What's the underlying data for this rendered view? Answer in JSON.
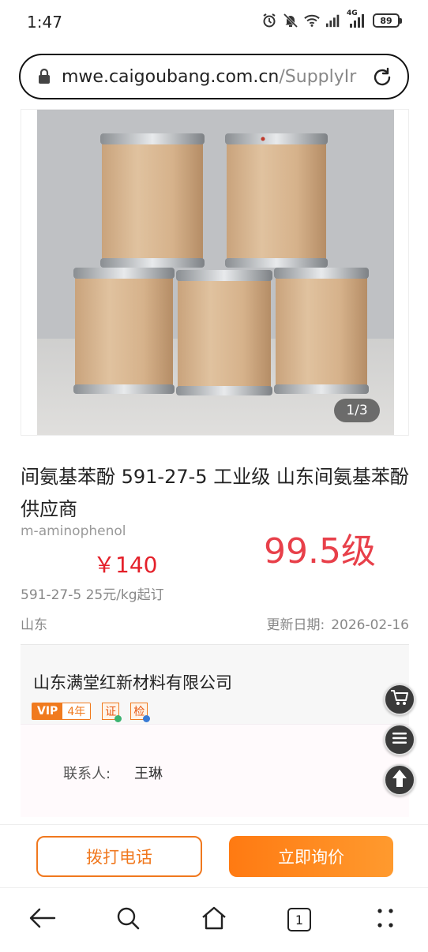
{
  "status_bar": {
    "time": "1:47",
    "battery": "89",
    "network": "4G"
  },
  "browser": {
    "url_domain": "mwe.caigoubang.com.cn",
    "url_path": "/SupplyIr",
    "tab_count": "1"
  },
  "gallery": {
    "counter": "1/3"
  },
  "product": {
    "title": "间氨基苯酚 591-27-5 工业级 山东间氨基苯酚供应商",
    "subtitle": "m-aminophenol",
    "grade": "99.5级",
    "price": "￥140",
    "spec": "591-27-5 25元/kg起订",
    "region": "山东",
    "update_label": "更新日期:",
    "update_date": "2026-02-16"
  },
  "company": {
    "name": "山东满堂红新材料有限公司",
    "vip_label": "VIP",
    "vip_years": "4年",
    "cert_badge": "证",
    "inspect_badge": "检",
    "contact_label": "联系人:",
    "contact_name": "王琳"
  },
  "actions": {
    "call": "拨打电话",
    "inquiry": "立即询价"
  },
  "colors": {
    "accent_orange": "#f0781e",
    "price_red": "#e4202a",
    "grade_red": "#e8404a"
  },
  "icons": [
    "lock-icon",
    "reload-icon",
    "cart-icon",
    "menu-icon",
    "up-arrow-icon",
    "back-icon",
    "search-icon",
    "home-icon",
    "more-icon"
  ]
}
